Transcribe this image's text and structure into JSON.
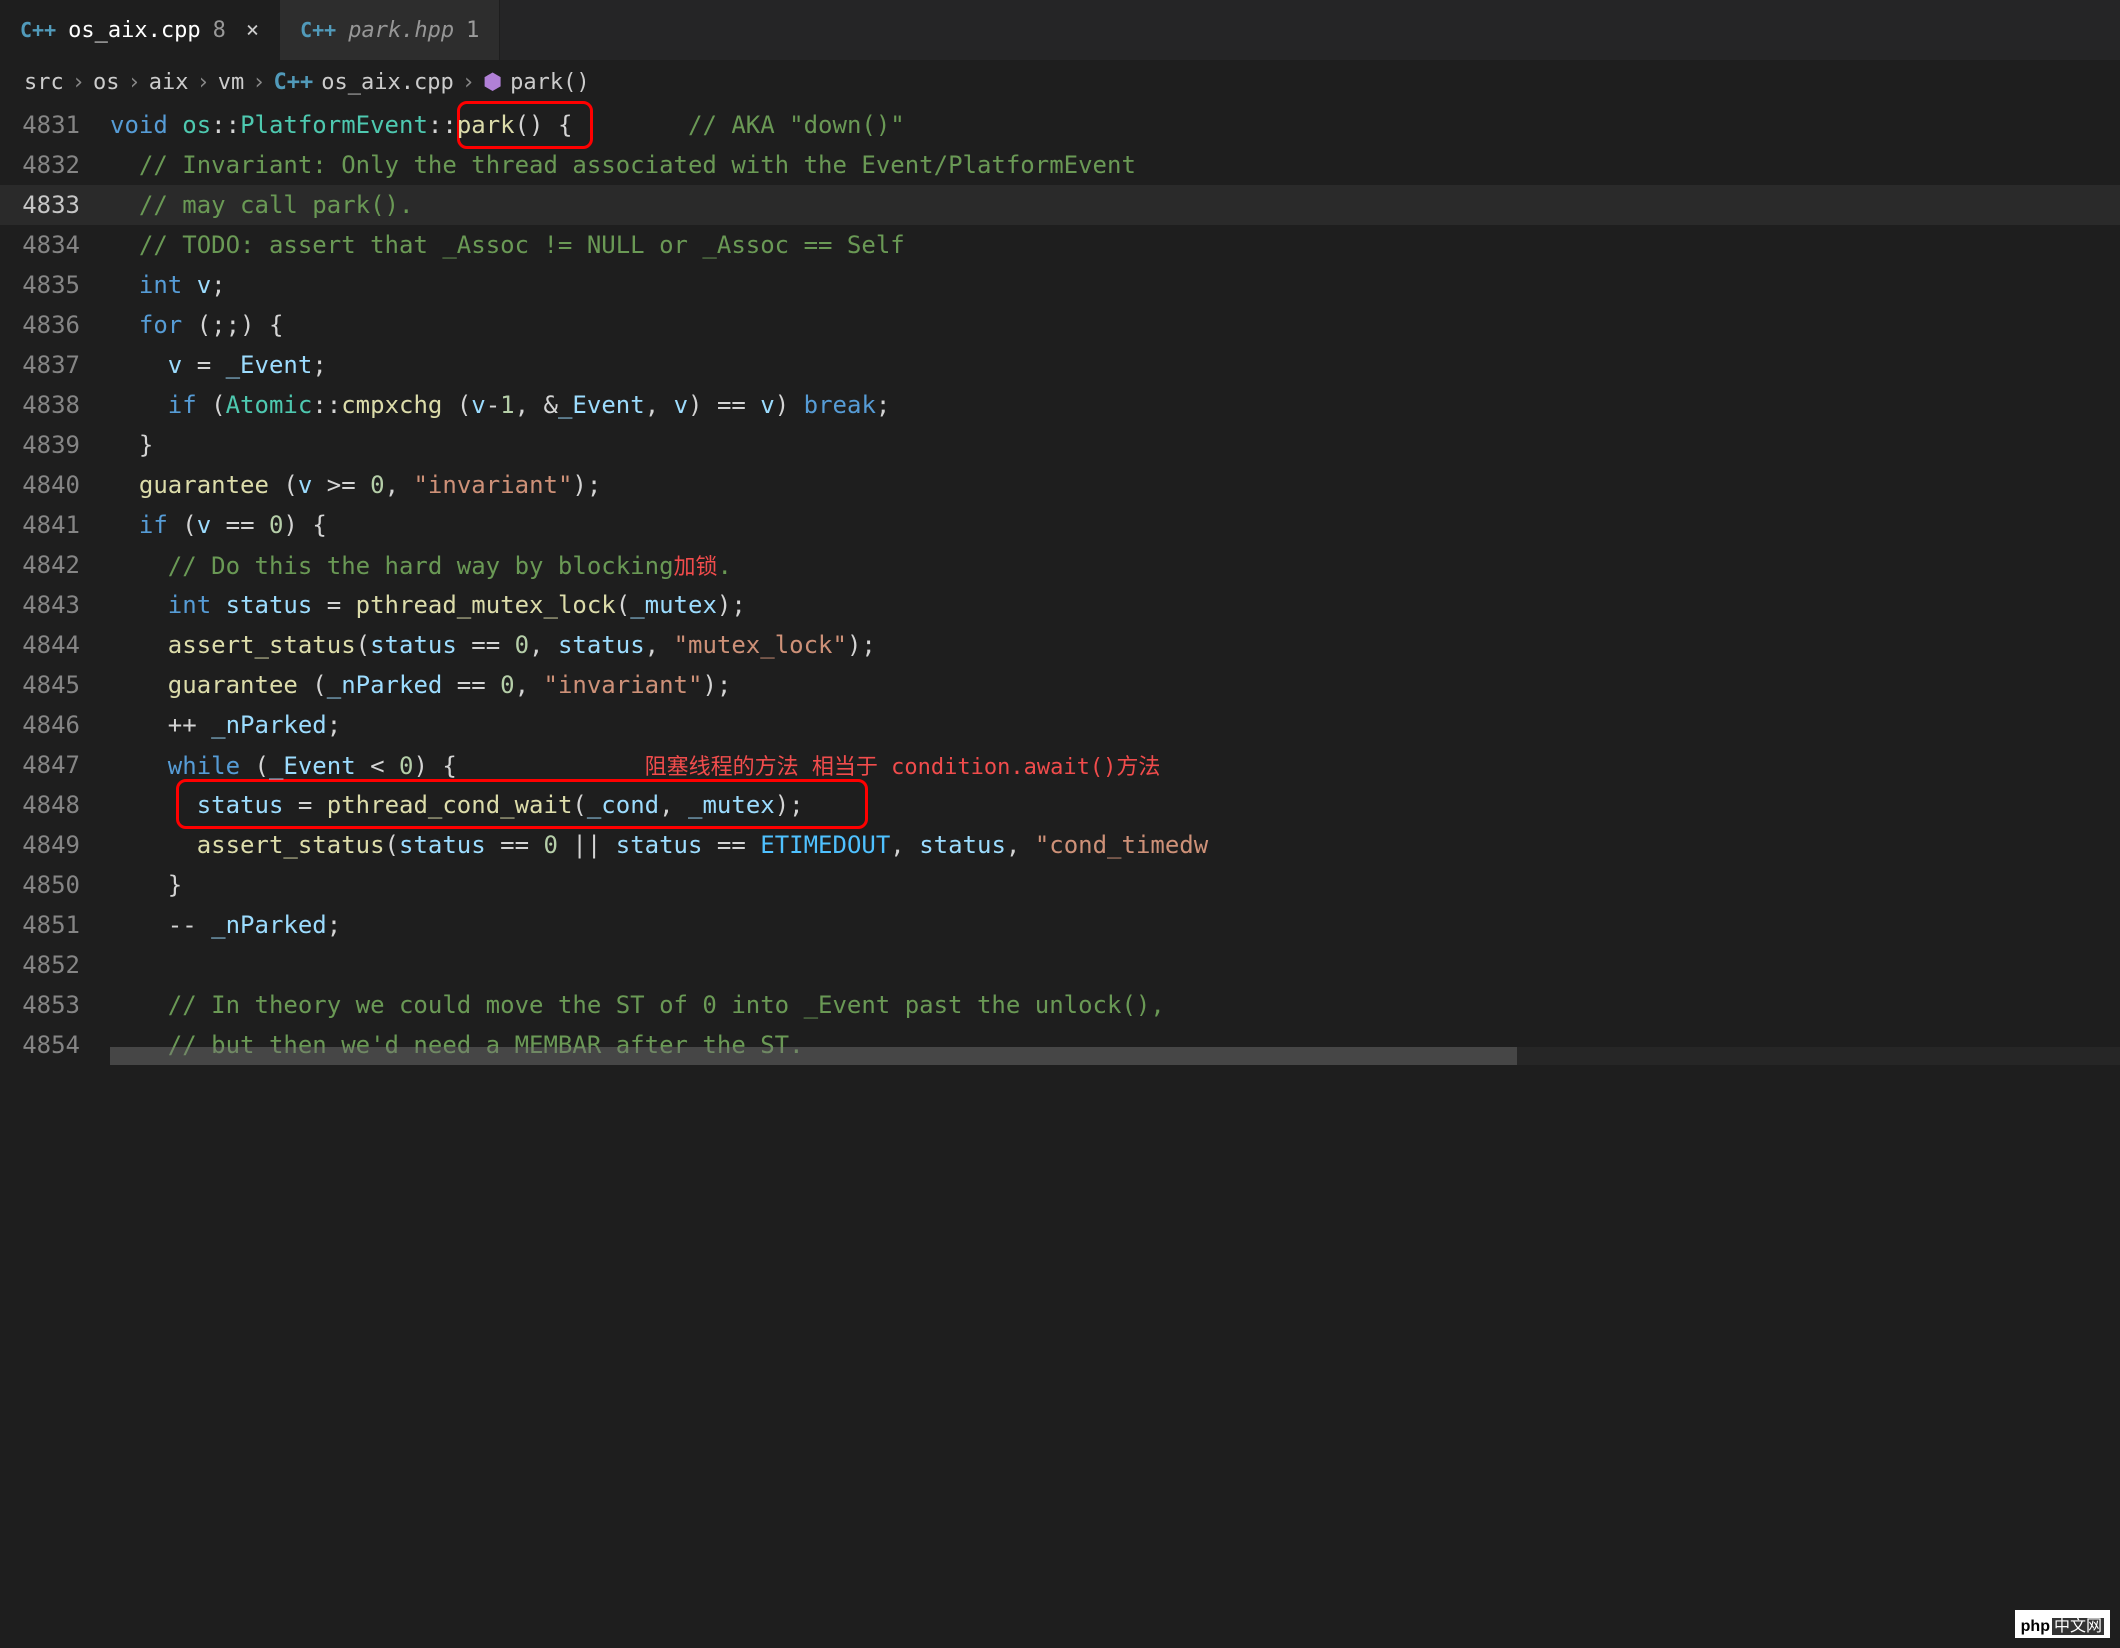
{
  "tabs": [
    {
      "icon": "C++",
      "filename": "os_aix.cpp",
      "badge": "8",
      "active": true,
      "close": "×"
    },
    {
      "icon": "C++",
      "filename": "park.hpp",
      "badge": "1",
      "active": false,
      "italic": true
    }
  ],
  "breadcrumbs": {
    "parts": [
      "src",
      "os",
      "aix",
      "vm"
    ],
    "file_icon": "C++",
    "file": "os_aix.cpp",
    "func_icon": "⬢",
    "func": "park()"
  },
  "annotations": {
    "lock_note": "加锁",
    "block_note": "阻塞线程的方法 相当于 condition.await()方法"
  },
  "lines": [
    {
      "n": "4831",
      "tokens": [
        {
          "t": "void ",
          "c": "kw"
        },
        {
          "t": "os",
          "c": "type"
        },
        {
          "t": "::",
          "c": "op"
        },
        {
          "t": "PlatformEvent",
          "c": "type"
        },
        {
          "t": "::",
          "c": "op"
        },
        {
          "t": "park",
          "c": "func"
        },
        {
          "t": "() {        ",
          "c": "op"
        },
        {
          "t": "// AKA \"down()\"",
          "c": "cmt"
        }
      ]
    },
    {
      "n": "4832",
      "indent": 1,
      "tokens": [
        {
          "t": "// Invariant: Only the thread associated with the Event/PlatformEvent",
          "c": "cmt"
        }
      ]
    },
    {
      "n": "4833",
      "indent": 1,
      "current": true,
      "tokens": [
        {
          "t": "// may call park().",
          "c": "cmt"
        }
      ]
    },
    {
      "n": "4834",
      "indent": 1,
      "tokens": [
        {
          "t": "// TODO: assert that _Assoc != NULL or _Assoc == Self",
          "c": "cmt"
        }
      ]
    },
    {
      "n": "4835",
      "indent": 1,
      "tokens": [
        {
          "t": "int ",
          "c": "kw"
        },
        {
          "t": "v",
          "c": "var"
        },
        {
          "t": ";",
          "c": "op"
        }
      ]
    },
    {
      "n": "4836",
      "indent": 1,
      "tokens": [
        {
          "t": "for ",
          "c": "kw"
        },
        {
          "t": "(;;) {",
          "c": "op"
        }
      ]
    },
    {
      "n": "4837",
      "indent": 2,
      "tokens": [
        {
          "t": "v",
          "c": "var"
        },
        {
          "t": " = ",
          "c": "op"
        },
        {
          "t": "_Event",
          "c": "var"
        },
        {
          "t": ";",
          "c": "op"
        }
      ]
    },
    {
      "n": "4838",
      "indent": 2,
      "tokens": [
        {
          "t": "if ",
          "c": "kw"
        },
        {
          "t": "(",
          "c": "op"
        },
        {
          "t": "Atomic",
          "c": "type"
        },
        {
          "t": "::",
          "c": "op"
        },
        {
          "t": "cmpxchg ",
          "c": "func"
        },
        {
          "t": "(",
          "c": "op"
        },
        {
          "t": "v",
          "c": "var"
        },
        {
          "t": "-",
          "c": "op"
        },
        {
          "t": "1",
          "c": "num"
        },
        {
          "t": ", &",
          "c": "op"
        },
        {
          "t": "_Event",
          "c": "var"
        },
        {
          "t": ", ",
          "c": "op"
        },
        {
          "t": "v",
          "c": "var"
        },
        {
          "t": ") == ",
          "c": "op"
        },
        {
          "t": "v",
          "c": "var"
        },
        {
          "t": ") ",
          "c": "op"
        },
        {
          "t": "break",
          "c": "kw"
        },
        {
          "t": ";",
          "c": "op"
        }
      ]
    },
    {
      "n": "4839",
      "indent": 1,
      "tokens": [
        {
          "t": "}",
          "c": "op"
        }
      ]
    },
    {
      "n": "4840",
      "indent": 1,
      "tokens": [
        {
          "t": "guarantee ",
          "c": "func"
        },
        {
          "t": "(",
          "c": "op"
        },
        {
          "t": "v",
          "c": "var"
        },
        {
          "t": " >= ",
          "c": "op"
        },
        {
          "t": "0",
          "c": "num"
        },
        {
          "t": ", ",
          "c": "op"
        },
        {
          "t": "\"invariant\"",
          "c": "str"
        },
        {
          "t": ");",
          "c": "op"
        }
      ]
    },
    {
      "n": "4841",
      "indent": 1,
      "tokens": [
        {
          "t": "if ",
          "c": "kw"
        },
        {
          "t": "(",
          "c": "op"
        },
        {
          "t": "v",
          "c": "var"
        },
        {
          "t": " == ",
          "c": "op"
        },
        {
          "t": "0",
          "c": "num"
        },
        {
          "t": ") {",
          "c": "op"
        }
      ]
    },
    {
      "n": "4842",
      "indent": 2,
      "tokens": [
        {
          "t": "// Do this the hard way by blocking",
          "c": "cmt"
        },
        {
          "t": "加锁",
          "c": "annotation-red"
        },
        {
          "t": ".",
          "c": "cmt"
        }
      ]
    },
    {
      "n": "4843",
      "indent": 2,
      "tokens": [
        {
          "t": "int ",
          "c": "kw"
        },
        {
          "t": "status",
          "c": "var"
        },
        {
          "t": " = ",
          "c": "op"
        },
        {
          "t": "pthread_mutex_lock",
          "c": "func"
        },
        {
          "t": "(",
          "c": "op"
        },
        {
          "t": "_mutex",
          "c": "var"
        },
        {
          "t": ");",
          "c": "op"
        }
      ]
    },
    {
      "n": "4844",
      "indent": 2,
      "tokens": [
        {
          "t": "assert_status",
          "c": "func"
        },
        {
          "t": "(",
          "c": "op"
        },
        {
          "t": "status",
          "c": "var"
        },
        {
          "t": " == ",
          "c": "op"
        },
        {
          "t": "0",
          "c": "num"
        },
        {
          "t": ", ",
          "c": "op"
        },
        {
          "t": "status",
          "c": "var"
        },
        {
          "t": ", ",
          "c": "op"
        },
        {
          "t": "\"mutex_lock\"",
          "c": "str"
        },
        {
          "t": ");",
          "c": "op"
        }
      ]
    },
    {
      "n": "4845",
      "indent": 2,
      "tokens": [
        {
          "t": "guarantee ",
          "c": "func"
        },
        {
          "t": "(",
          "c": "op"
        },
        {
          "t": "_nParked",
          "c": "var"
        },
        {
          "t": " == ",
          "c": "op"
        },
        {
          "t": "0",
          "c": "num"
        },
        {
          "t": ", ",
          "c": "op"
        },
        {
          "t": "\"invariant\"",
          "c": "str"
        },
        {
          "t": ");",
          "c": "op"
        }
      ]
    },
    {
      "n": "4846",
      "indent": 2,
      "tokens": [
        {
          "t": "++ ",
          "c": "op"
        },
        {
          "t": "_nParked",
          "c": "var"
        },
        {
          "t": ";",
          "c": "op"
        }
      ]
    },
    {
      "n": "4847",
      "indent": 2,
      "tokens": [
        {
          "t": "while ",
          "c": "kw"
        },
        {
          "t": "(",
          "c": "op"
        },
        {
          "t": "_Event",
          "c": "var"
        },
        {
          "t": " < ",
          "c": "op"
        },
        {
          "t": "0",
          "c": "num"
        },
        {
          "t": ") {             ",
          "c": "op"
        },
        {
          "t": "阻塞线程的方法 相当于 condition.await()方法",
          "c": "annotation-red"
        }
      ]
    },
    {
      "n": "4848",
      "indent": 3,
      "tokens": [
        {
          "t": "status",
          "c": "var"
        },
        {
          "t": " = ",
          "c": "op"
        },
        {
          "t": "pthread_cond_wait",
          "c": "func"
        },
        {
          "t": "(",
          "c": "op"
        },
        {
          "t": "_cond",
          "c": "var"
        },
        {
          "t": ", ",
          "c": "op"
        },
        {
          "t": "_mutex",
          "c": "var"
        },
        {
          "t": ");",
          "c": "op"
        }
      ]
    },
    {
      "n": "4849",
      "indent": 3,
      "tokens": [
        {
          "t": "assert_status",
          "c": "func"
        },
        {
          "t": "(",
          "c": "op"
        },
        {
          "t": "status",
          "c": "var"
        },
        {
          "t": " == ",
          "c": "op"
        },
        {
          "t": "0",
          "c": "num"
        },
        {
          "t": " || ",
          "c": "op"
        },
        {
          "t": "status",
          "c": "var"
        },
        {
          "t": " == ",
          "c": "op"
        },
        {
          "t": "ETIMEDOUT",
          "c": "const"
        },
        {
          "t": ", ",
          "c": "op"
        },
        {
          "t": "status",
          "c": "var"
        },
        {
          "t": ", ",
          "c": "op"
        },
        {
          "t": "\"cond_timedw",
          "c": "str"
        }
      ]
    },
    {
      "n": "4850",
      "indent": 2,
      "tokens": [
        {
          "t": "}",
          "c": "op"
        }
      ]
    },
    {
      "n": "4851",
      "indent": 2,
      "tokens": [
        {
          "t": "-- ",
          "c": "op"
        },
        {
          "t": "_nParked",
          "c": "var"
        },
        {
          "t": ";",
          "c": "op"
        }
      ]
    },
    {
      "n": "4852",
      "indent": 2,
      "tokens": []
    },
    {
      "n": "4853",
      "indent": 2,
      "tokens": [
        {
          "t": "// In theory we could move the ST of 0 into _Event past the unlock(),",
          "c": "cmt"
        }
      ]
    },
    {
      "n": "4854",
      "indent": 2,
      "tokens": [
        {
          "t": "// but then we'd need a MEMBAR after the ST.",
          "c": "cmt"
        }
      ]
    }
  ],
  "watermark": {
    "left": "php",
    "right": "中文网"
  }
}
